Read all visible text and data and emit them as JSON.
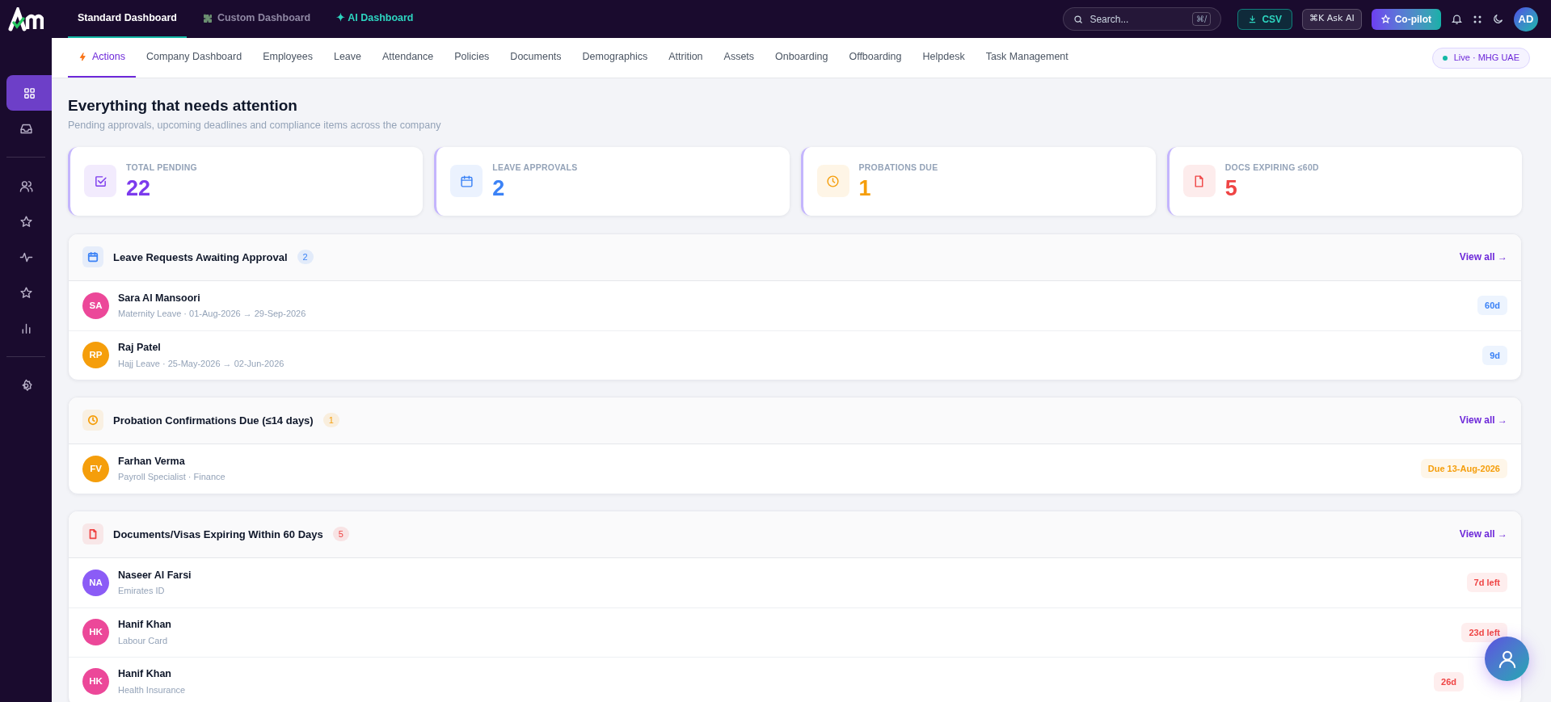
{
  "top_tabs": [
    {
      "label": "Standard Dashboard",
      "selected": true,
      "kind": "plain"
    },
    {
      "label": "Custom Dashboard",
      "selected": false,
      "kind": "puzzle"
    },
    {
      "label": "✦ AI Dashboard",
      "selected": false,
      "kind": "ai"
    }
  ],
  "search": {
    "placeholder": "Search...",
    "shortcut": "⌘/"
  },
  "toolbar": {
    "csv": "CSV",
    "ask_ai": "⌘K Ask AI",
    "copilot": "Co-pilot",
    "avatar": "AD"
  },
  "sidebar": {
    "items": [
      {
        "kind": "grid",
        "selected": true
      },
      {
        "kind": "inbox",
        "selected": false
      },
      {
        "kind": "people",
        "selected": false
      },
      {
        "kind": "star",
        "selected": false
      },
      {
        "kind": "pulse",
        "selected": false
      },
      {
        "kind": "star",
        "selected": false
      },
      {
        "kind": "chart",
        "selected": false
      },
      {
        "kind": "gear",
        "selected": false
      }
    ]
  },
  "tabs": [
    {
      "label": "Actions",
      "selected": true
    },
    {
      "label": "Company Dashboard",
      "selected": false
    },
    {
      "label": "Employees",
      "selected": false
    },
    {
      "label": "Leave",
      "selected": false
    },
    {
      "label": "Attendance",
      "selected": false
    },
    {
      "label": "Policies",
      "selected": false
    },
    {
      "label": "Documents",
      "selected": false
    },
    {
      "label": "Demographics",
      "selected": false
    },
    {
      "label": "Attrition",
      "selected": false
    },
    {
      "label": "Assets",
      "selected": false
    },
    {
      "label": "Onboarding",
      "selected": false
    },
    {
      "label": "Offboarding",
      "selected": false
    },
    {
      "label": "Helpdesk",
      "selected": false
    },
    {
      "label": "Task Management",
      "selected": false
    }
  ],
  "live_badge": "Live · MHG UAE",
  "heading": "Everything that needs attention",
  "subheading": "Pending approvals, upcoming deadlines and compliance items across the company",
  "stats": [
    {
      "label": "TOTAL PENDING",
      "value": "22",
      "kind": "check",
      "color": "#7c3aed"
    },
    {
      "label": "LEAVE APPROVALS",
      "value": "2",
      "kind": "calendar",
      "color": "#3b82f6"
    },
    {
      "label": "PROBATIONS DUE",
      "value": "1",
      "kind": "clock",
      "color": "#f59e0b"
    },
    {
      "label": "DOCS EXPIRING ≤60D",
      "value": "5",
      "kind": "document",
      "color": "#ef4444"
    }
  ],
  "sections": [
    {
      "title": "Leave Requests Awaiting Approval",
      "count": "2",
      "kind": "calendar",
      "color": "#3b82f6",
      "link": "View all →",
      "rows": [
        {
          "initials": "SA",
          "color": "#ec4899",
          "name": "Sara Al Mansoori",
          "detail": "Maternity Leave · 01-Aug-2026 → 29-Sep-2026",
          "badge": "60d"
        },
        {
          "initials": "RP",
          "color": "#f59e0b",
          "name": "Raj Patel",
          "detail": "Hajj Leave · 25-May-2026 → 02-Jun-2026",
          "badge": "9d"
        }
      ]
    },
    {
      "title": "Probation Confirmations Due (≤14 days)",
      "count": "1",
      "kind": "clock",
      "color": "#f59e0b",
      "link": "View all →",
      "rows": [
        {
          "initials": "FV",
          "color": "#f59e0b",
          "name": "Farhan Verma",
          "detail": "Payroll Specialist · Finance",
          "badge": "Due 13-Aug-2026"
        }
      ]
    },
    {
      "title": "Documents/Visas Expiring Within 60 Days",
      "count": "5",
      "kind": "document",
      "color": "#ef4444",
      "link": "View all →",
      "rows": [
        {
          "initials": "NA",
          "color": "#8b5cf6",
          "name": "Naseer Al Farsi",
          "detail": "Emirates ID",
          "badge": "7d left"
        },
        {
          "initials": "HK",
          "color": "#ec4899",
          "name": "Hanif Khan",
          "detail": "Labour Card",
          "badge": "23d left"
        },
        {
          "initials": "HK",
          "color": "#ec4899",
          "name": "Hanif Khan",
          "detail": "Health Insurance",
          "badge": "26d"
        }
      ]
    }
  ]
}
